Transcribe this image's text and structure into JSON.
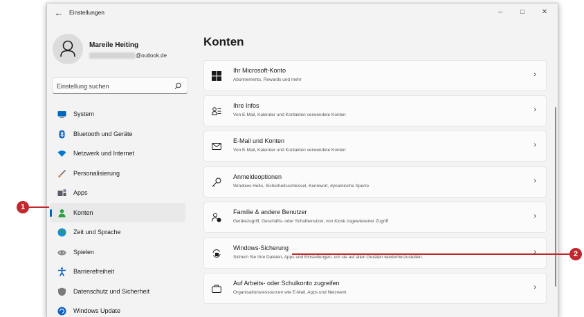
{
  "window": {
    "title": "Einstellungen",
    "controls": {
      "minimize": "–",
      "maximize": "□",
      "close": "✕"
    }
  },
  "profile": {
    "name": "Mareile Heiting",
    "email_suffix": "@outlook.de"
  },
  "search": {
    "placeholder": "Einstellung suchen"
  },
  "nav": {
    "items": [
      {
        "label": "System",
        "icon": "monitor-icon",
        "color": "#0067c0"
      },
      {
        "label": "Bluetooth und Geräte",
        "icon": "bluetooth-icon",
        "color": "#0a5fc2"
      },
      {
        "label": "Netzwerk und Internet",
        "icon": "wifi-icon",
        "color": "#0078d4"
      },
      {
        "label": "Personalisierung",
        "icon": "brush-icon",
        "color": "#e07b39"
      },
      {
        "label": "Apps",
        "icon": "apps-icon",
        "color": "#5a5a6a"
      },
      {
        "label": "Konten",
        "icon": "account-icon",
        "color": "#2ea043",
        "active": true
      },
      {
        "label": "Zeit und Sprache",
        "icon": "globe-clock-icon",
        "color": "#1a8fd6"
      },
      {
        "label": "Spielen",
        "icon": "gamepad-icon",
        "color": "#8a8a8a"
      },
      {
        "label": "Barrierefreiheit",
        "icon": "accessibility-icon",
        "color": "#0a5fc2"
      },
      {
        "label": "Datenschutz und Sicherheit",
        "icon": "shield-icon",
        "color": "#7a7a7a"
      },
      {
        "label": "Windows Update",
        "icon": "update-icon",
        "color": "#0a5fc2"
      }
    ]
  },
  "main": {
    "title": "Konten",
    "cards": [
      {
        "title": "Ihr Microsoft-Konto",
        "subtitle": "Abonnements, Rewards und mehr",
        "icon": "microsoft-logo-icon"
      },
      {
        "title": "Ihre Infos",
        "subtitle": "Von E-Mail, Kalender und Kontakten verwendete Konten",
        "icon": "person-info-icon"
      },
      {
        "title": "E-Mail und Konten",
        "subtitle": "Von E-Mail, Kalender und Kontakten verwendete Konten",
        "icon": "mail-icon"
      },
      {
        "title": "Anmeldeoptionen",
        "subtitle": "Windows Hello, Sicherheitsschlüssel, Kennwort, dynamische Sperre",
        "icon": "key-icon"
      },
      {
        "title": "Familie & andere Benutzer",
        "subtitle": "Gerätezugriff, Geschäfts- oder Schulbenutzer, von Kiosk zugewiesener Zugriff",
        "icon": "family-icon"
      },
      {
        "title": "Windows-Sicherung",
        "subtitle": "Sichern Sie Ihre Dateien, Apps und Einstellungen, um sie auf allen Geräten wiederherzustellen.",
        "icon": "backup-icon"
      },
      {
        "title": "Auf Arbeits- oder Schulkonto zugreifen",
        "subtitle": "Organisationsressourcen wie E-Mail, Apps und Netzwerk",
        "icon": "briefcase-icon"
      }
    ]
  },
  "callouts": {
    "one": "1",
    "two": "2"
  }
}
